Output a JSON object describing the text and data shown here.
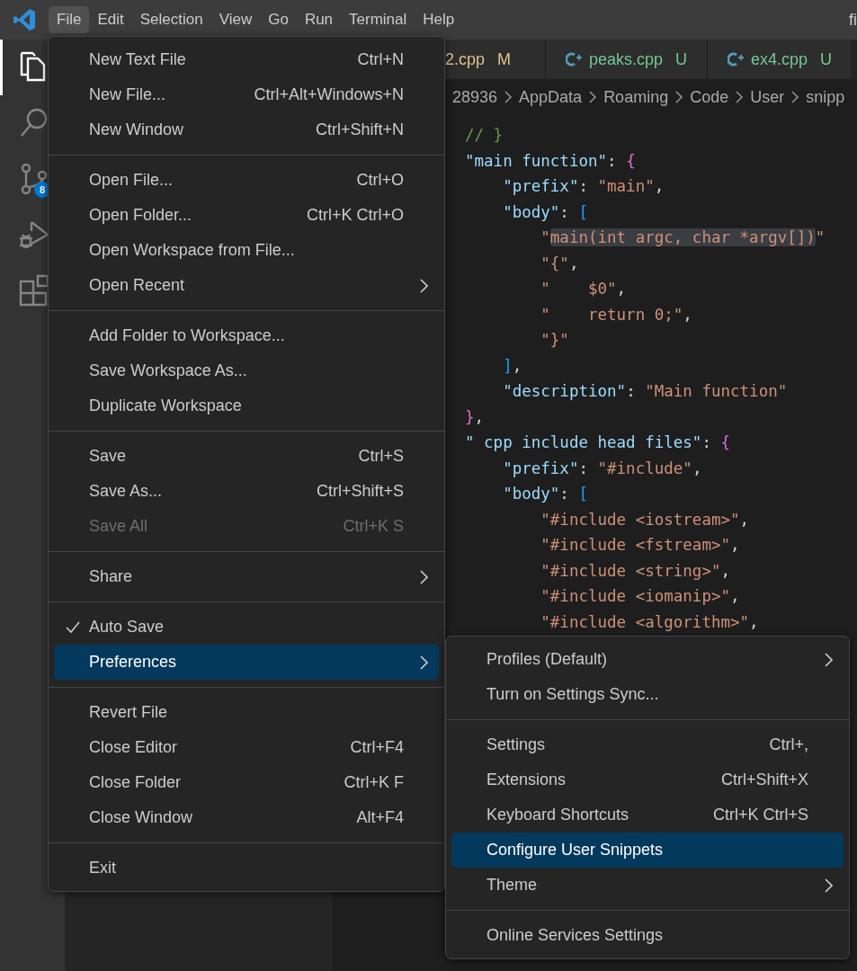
{
  "menu_bar": [
    {
      "label": "File",
      "selected": true
    },
    {
      "label": "Edit",
      "selected": false
    },
    {
      "label": "Selection",
      "selected": false
    },
    {
      "label": "View",
      "selected": false
    },
    {
      "label": "Go",
      "selected": false
    },
    {
      "label": "Run",
      "selected": false
    },
    {
      "label": "Terminal",
      "selected": false
    },
    {
      "label": "Help",
      "selected": false
    }
  ],
  "window_title": "fi",
  "activity_bar": [
    {
      "kind": "files",
      "selected": true
    },
    {
      "kind": "search",
      "selected": false
    },
    {
      "kind": "source-control",
      "selected": false,
      "badge": "8"
    },
    {
      "kind": "debug",
      "selected": false
    },
    {
      "kind": "extensions",
      "selected": false
    }
  ],
  "tabs": [
    {
      "label": "2.cpp",
      "status": "M",
      "kind": "modified",
      "icon": false
    },
    {
      "label": "peaks.cpp",
      "status": "U",
      "kind": "untracked",
      "icon": true
    },
    {
      "label": "ex4.cpp",
      "status": "U",
      "kind": "untracked",
      "icon": true
    }
  ],
  "breadcrumb": [
    "28936",
    "AppData",
    "Roaming",
    "Code",
    "User",
    "snipp"
  ],
  "code_lines": [
    [
      {
        "text": "// }",
        "kind": "comment"
      }
    ],
    [
      {
        "text": "\"main function\"",
        "kind": "key"
      },
      {
        "text": ": ",
        "kind": "punct"
      },
      {
        "text": "{",
        "kind": "brace"
      }
    ],
    [
      {
        "text": "    \"prefix\"",
        "kind": "key"
      },
      {
        "text": ": ",
        "kind": "punct"
      },
      {
        "text": "\"main\"",
        "kind": "string"
      },
      {
        "text": ",",
        "kind": "punct"
      }
    ],
    [
      {
        "text": "    \"body\"",
        "kind": "key"
      },
      {
        "text": ": ",
        "kind": "punct"
      },
      {
        "text": "[",
        "kind": "bracket"
      }
    ],
    [
      {
        "text": "        \"",
        "kind": "string"
      },
      {
        "text": "main(int argc, char *argv[])",
        "kind": "string",
        "highlighted": true
      },
      {
        "text": "\"",
        "kind": "string"
      }
    ],
    [
      {
        "text": "        \"{\"",
        "kind": "string"
      },
      {
        "text": ",",
        "kind": "punct"
      }
    ],
    [
      {
        "text": "        \"    $0\"",
        "kind": "string"
      },
      {
        "text": ",",
        "kind": "punct"
      }
    ],
    [
      {
        "text": "        \"    return 0;\"",
        "kind": "string"
      },
      {
        "text": ",",
        "kind": "punct"
      }
    ],
    [
      {
        "text": "        \"}\"",
        "kind": "string"
      }
    ],
    [
      {
        "text": "    ]",
        "kind": "bracket"
      },
      {
        "text": ",",
        "kind": "punct"
      }
    ],
    [
      {
        "text": "    \"description\"",
        "kind": "key"
      },
      {
        "text": ": ",
        "kind": "punct"
      },
      {
        "text": "\"Main function\"",
        "kind": "string"
      }
    ],
    [
      {
        "text": "}",
        "kind": "brace"
      },
      {
        "text": ",",
        "kind": "punct"
      }
    ],
    [
      {
        "text": "\" cpp include head files\"",
        "kind": "key"
      },
      {
        "text": ": ",
        "kind": "punct"
      },
      {
        "text": "{",
        "kind": "brace"
      }
    ],
    [
      {
        "text": "    \"prefix\"",
        "kind": "key"
      },
      {
        "text": ": ",
        "kind": "punct"
      },
      {
        "text": "\"#include\"",
        "kind": "string"
      },
      {
        "text": ",",
        "kind": "punct"
      }
    ],
    [
      {
        "text": "    \"body\"",
        "kind": "key"
      },
      {
        "text": ": ",
        "kind": "punct"
      },
      {
        "text": "[",
        "kind": "bracket"
      }
    ],
    [
      {
        "text": "        \"#include <iostream>\"",
        "kind": "string"
      },
      {
        "text": ",",
        "kind": "punct"
      }
    ],
    [
      {
        "text": "        \"#include <fstream>\"",
        "kind": "string"
      },
      {
        "text": ",",
        "kind": "punct"
      }
    ],
    [
      {
        "text": "        \"#include <string>\"",
        "kind": "string"
      },
      {
        "text": ",",
        "kind": "punct"
      }
    ],
    [
      {
        "text": "        \"#include <iomanip>\"",
        "kind": "string"
      },
      {
        "text": ",",
        "kind": "punct"
      }
    ],
    [
      {
        "text": "        \"#include <algorithm>\"",
        "kind": "string"
      },
      {
        "text": ",",
        "kind": "punct"
      }
    ]
  ],
  "file_menu": [
    [
      {
        "label": "New Text File",
        "shortcut": "Ctrl+N",
        "submenu": false,
        "checked": false,
        "disabled": false,
        "selected": false
      },
      {
        "label": "New File...",
        "shortcut": "Ctrl+Alt+Windows+N",
        "submenu": false,
        "checked": false,
        "disabled": false,
        "selected": false
      },
      {
        "label": "New Window",
        "shortcut": "Ctrl+Shift+N",
        "submenu": false,
        "checked": false,
        "disabled": false,
        "selected": false
      }
    ],
    [
      {
        "label": "Open File...",
        "shortcut": "Ctrl+O",
        "submenu": false,
        "checked": false,
        "disabled": false,
        "selected": false
      },
      {
        "label": "Open Folder...",
        "shortcut": "Ctrl+K Ctrl+O",
        "submenu": false,
        "checked": false,
        "disabled": false,
        "selected": false
      },
      {
        "label": "Open Workspace from File...",
        "submenu": false,
        "checked": false,
        "disabled": false,
        "selected": false
      },
      {
        "label": "Open Recent",
        "submenu": true,
        "checked": false,
        "disabled": false,
        "selected": false
      }
    ],
    [
      {
        "label": "Add Folder to Workspace...",
        "submenu": false,
        "checked": false,
        "disabled": false,
        "selected": false
      },
      {
        "label": "Save Workspace As...",
        "submenu": false,
        "checked": false,
        "disabled": false,
        "selected": false
      },
      {
        "label": "Duplicate Workspace",
        "submenu": false,
        "checked": false,
        "disabled": false,
        "selected": false
      }
    ],
    [
      {
        "label": "Save",
        "shortcut": "Ctrl+S",
        "submenu": false,
        "checked": false,
        "disabled": false,
        "selected": false
      },
      {
        "label": "Save As...",
        "shortcut": "Ctrl+Shift+S",
        "submenu": false,
        "checked": false,
        "disabled": false,
        "selected": false
      },
      {
        "label": "Save All",
        "shortcut": "Ctrl+K S",
        "submenu": false,
        "checked": false,
        "disabled": true,
        "selected": false
      }
    ],
    [
      {
        "label": "Share",
        "submenu": true,
        "checked": false,
        "disabled": false,
        "selected": false
      }
    ],
    [
      {
        "label": "Auto Save",
        "submenu": false,
        "checked": true,
        "disabled": false,
        "selected": false
      },
      {
        "label": "Preferences",
        "submenu": true,
        "checked": false,
        "disabled": false,
        "selected": true
      }
    ],
    [
      {
        "label": "Revert File",
        "submenu": false,
        "checked": false,
        "disabled": false,
        "selected": false
      },
      {
        "label": "Close Editor",
        "shortcut": "Ctrl+F4",
        "submenu": false,
        "checked": false,
        "disabled": false,
        "selected": false
      },
      {
        "label": "Close Folder",
        "shortcut": "Ctrl+K F",
        "submenu": false,
        "checked": false,
        "disabled": false,
        "selected": false
      },
      {
        "label": "Close Window",
        "shortcut": "Alt+F4",
        "submenu": false,
        "checked": false,
        "disabled": false,
        "selected": false
      }
    ],
    [
      {
        "label": "Exit",
        "submenu": false,
        "checked": false,
        "disabled": false,
        "selected": false
      }
    ]
  ],
  "preferences_menu": [
    [
      {
        "label": "Profiles (Default)",
        "submenu": true,
        "checked": false,
        "disabled": false,
        "selected": false
      },
      {
        "label": "Turn on Settings Sync...",
        "submenu": false,
        "checked": false,
        "disabled": false,
        "selected": false
      }
    ],
    [
      {
        "label": "Settings",
        "shortcut": "Ctrl+,",
        "submenu": false,
        "checked": false,
        "disabled": false,
        "selected": false
      },
      {
        "label": "Extensions",
        "shortcut": "Ctrl+Shift+X",
        "submenu": false,
        "checked": false,
        "disabled": false,
        "selected": false
      },
      {
        "label": "Keyboard Shortcuts",
        "shortcut": "Ctrl+K Ctrl+S",
        "submenu": false,
        "checked": false,
        "disabled": false,
        "selected": false
      },
      {
        "label": "Configure User Snippets",
        "submenu": false,
        "checked": false,
        "disabled": false,
        "selected": true
      },
      {
        "label": "Theme",
        "submenu": true,
        "checked": false,
        "disabled": false,
        "selected": false
      }
    ],
    [
      {
        "label": "Online Services Settings",
        "submenu": false,
        "checked": false,
        "disabled": false,
        "selected": false
      }
    ]
  ]
}
